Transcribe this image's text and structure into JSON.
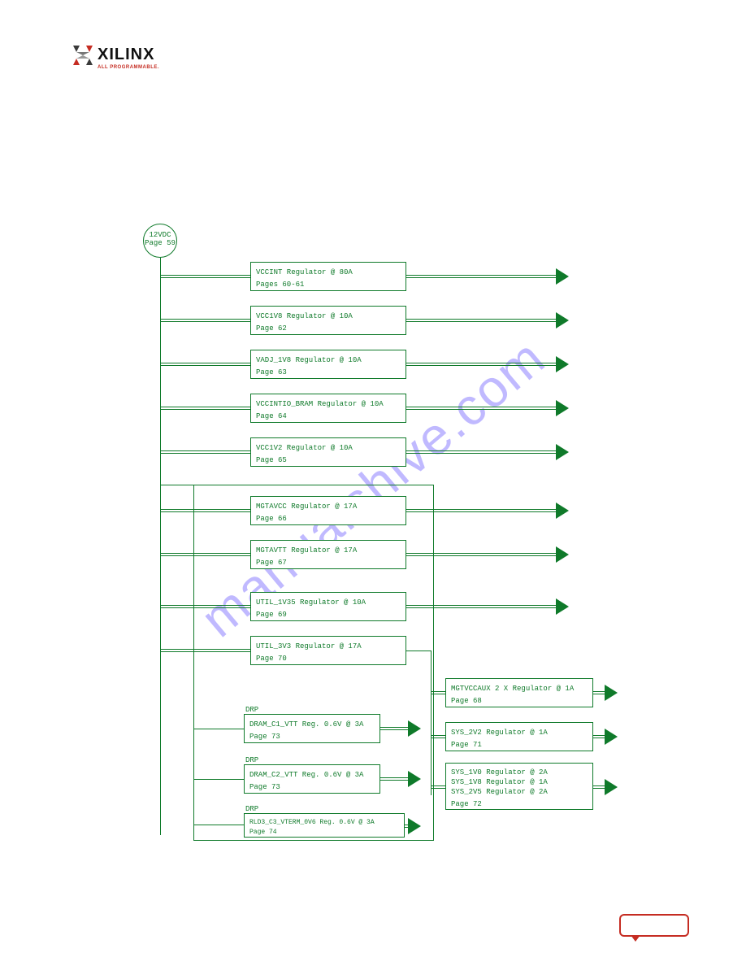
{
  "brand": {
    "name": "XILINX",
    "tagline": "ALL PROGRAMMABLE."
  },
  "watermark": "manualshive.com",
  "source": {
    "line1": "12VDC",
    "line2": "Page 59"
  },
  "regulators": [
    {
      "line1": "VCCINT Regulator @ 80A",
      "line2": "Pages 60-61"
    },
    {
      "line1": "VCC1V8 Regulator @ 10A",
      "line2": "Page 62"
    },
    {
      "line1": "VADJ_1V8 Regulator @ 10A",
      "line2": "Page 63"
    },
    {
      "line1": "VCCINTIO_BRAM  Regulator @ 10A",
      "line2": "Page 64"
    },
    {
      "line1": "VCC1V2 Regulator @ 10A",
      "line2": "Page 65"
    },
    {
      "line1": "MGTAVCC Regulator @ 17A",
      "line2": "Page 66"
    },
    {
      "line1": "MGTAVTT Regulator @ 17A",
      "line2": "Page 67"
    },
    {
      "line1": "UTIL_1V35 Regulator @ 10A",
      "line2": "Page 69"
    },
    {
      "line1": "UTIL_3V3 Regulator @ 17A",
      "line2": "Page 70"
    }
  ],
  "right": [
    {
      "line1": "MGTVCCAUX 2 X Regulator @ 1A",
      "line2": "Page 68"
    },
    {
      "line1": "SYS_2V2   Regulator @ 1A",
      "line2": "Page 71"
    },
    {
      "line1": "SYS_1V0 Regulator @ 2A",
      "line2": "SYS_1V8 Regulator @ 1A",
      "line3": "SYS_2V5 Regulator @ 2A",
      "line4": "Page 72"
    }
  ],
  "drp_label": "DRP",
  "drp": [
    {
      "line1": "DRAM_C1_VTT Reg. 0.6V @ 3A",
      "line2": "Page 73"
    },
    {
      "line1": "DRAM_C2_VTT Reg. 0.6V @ 3A",
      "line2": "Page 73"
    },
    {
      "line1": "RLD3_C3_VTERM_0V6 Reg. 0.6V @ 3A",
      "line2": "Page 74"
    }
  ]
}
